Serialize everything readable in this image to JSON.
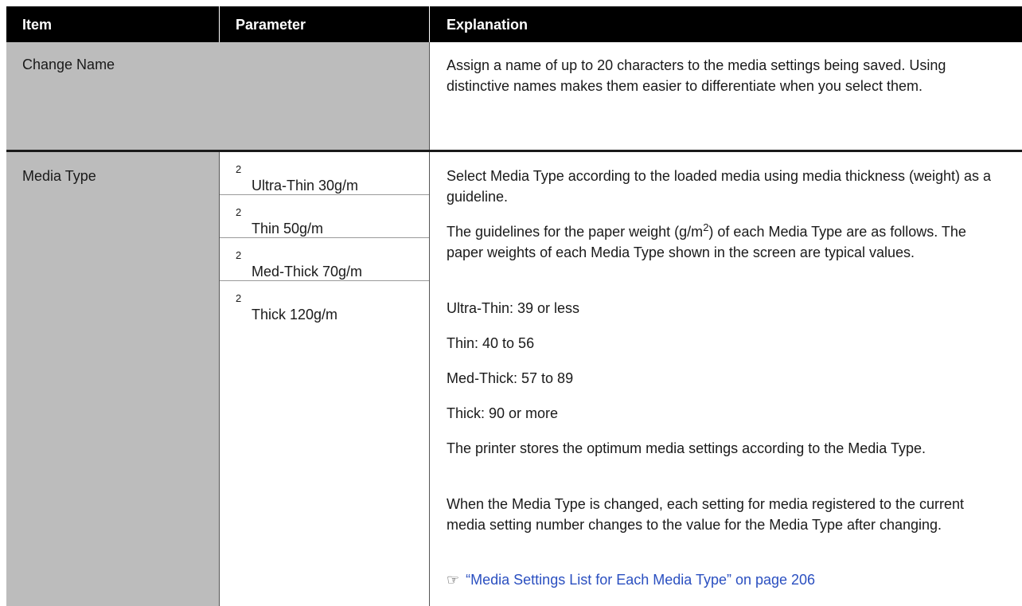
{
  "header": {
    "item": "Item",
    "parameter": "Parameter",
    "explanation": "Explanation"
  },
  "row_change_name": {
    "item": "Change Name",
    "explanation": "Assign a name of up to 20 characters to the media settings being saved. Using distinctive names makes them easier to differentiate when you select them."
  },
  "row_media_type": {
    "item": "Media Type",
    "params": [
      {
        "label": "Ultra-Thin 30g/m",
        "sup": "2"
      },
      {
        "label": "Thin 50g/m",
        "sup": "2"
      },
      {
        "label": "Med-Thick 70g/m",
        "sup": "2"
      },
      {
        "label": "Thick 120g/m",
        "sup": "2"
      }
    ],
    "expl_p1": "Select Media Type according to the loaded media using media thickness (weight) as a guideline.",
    "expl_p2_a": "The guidelines for the paper weight (g/m",
    "expl_p2_sup": "2",
    "expl_p2_b": ") of each Media Type are as follows. The paper weights of each Media Type shown in the screen are typical values.",
    "guidelines": [
      "Ultra-Thin: 39 or less",
      "Thin: 40 to 56",
      "Med-Thick: 57 to 89",
      "Thick: 90 or more"
    ],
    "expl_p3": "The printer stores the optimum media settings according to the Media Type.",
    "expl_p4": "When the Media Type is changed, each setting for media registered to the current media setting number changes to the value for the Media Type after changing.",
    "link_icon": "pointing-hand-icon",
    "link_text": "“Media Settings List for Each Media Type” on page 206"
  },
  "colors": {
    "header_bg": "#000000",
    "item_bg": "#bcbcbc",
    "link": "#2a4fc0"
  }
}
